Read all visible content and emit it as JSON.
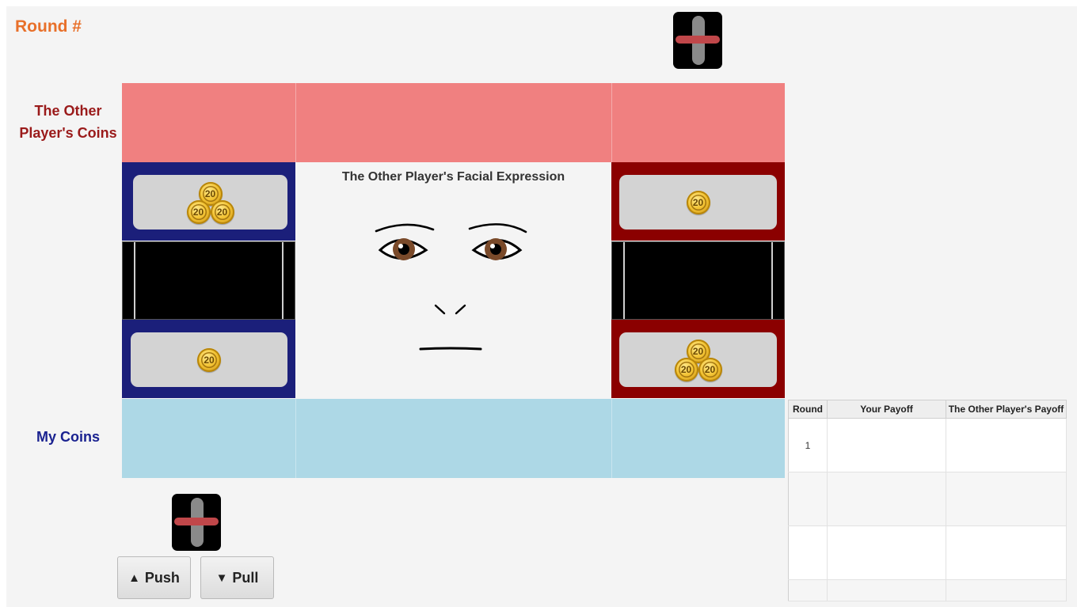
{
  "header": {
    "round_label": "Round #"
  },
  "labels": {
    "other_coins": "The Other Player's Coins",
    "my_coins": "My Coins",
    "face_title": "The Other Player's Facial Expression"
  },
  "payoff_grid": {
    "left_top": {
      "coins": [
        "20",
        "20",
        "20"
      ],
      "color": "#1b1f7a"
    },
    "left_bottom": {
      "coins": [
        "20"
      ],
      "color": "#1b1f7a"
    },
    "right_top": {
      "coins": [
        "20"
      ],
      "color": "#8b0000"
    },
    "right_bottom": {
      "coins": [
        "20",
        "20",
        "20"
      ],
      "color": "#8b0000"
    }
  },
  "controls": {
    "push_label": "Push",
    "push_glyph": "▲",
    "pull_label": "Pull",
    "pull_glyph": "▼"
  },
  "history_table": {
    "columns": [
      "Round",
      "Your Payoff",
      "The Other Player's Payoff"
    ],
    "rows": [
      [
        "1",
        "",
        ""
      ],
      [
        "",
        "",
        ""
      ],
      [
        "",
        "",
        ""
      ],
      [
        "",
        "",
        ""
      ]
    ]
  },
  "colors": {
    "round_label": "#e8702a",
    "other_band": "#f08080",
    "my_band": "#add8e6",
    "other_label": "#9a1a1a",
    "my_label": "#1a2290"
  },
  "icons": {
    "lever": "lever-icon",
    "coin": "coin-20-icon"
  }
}
